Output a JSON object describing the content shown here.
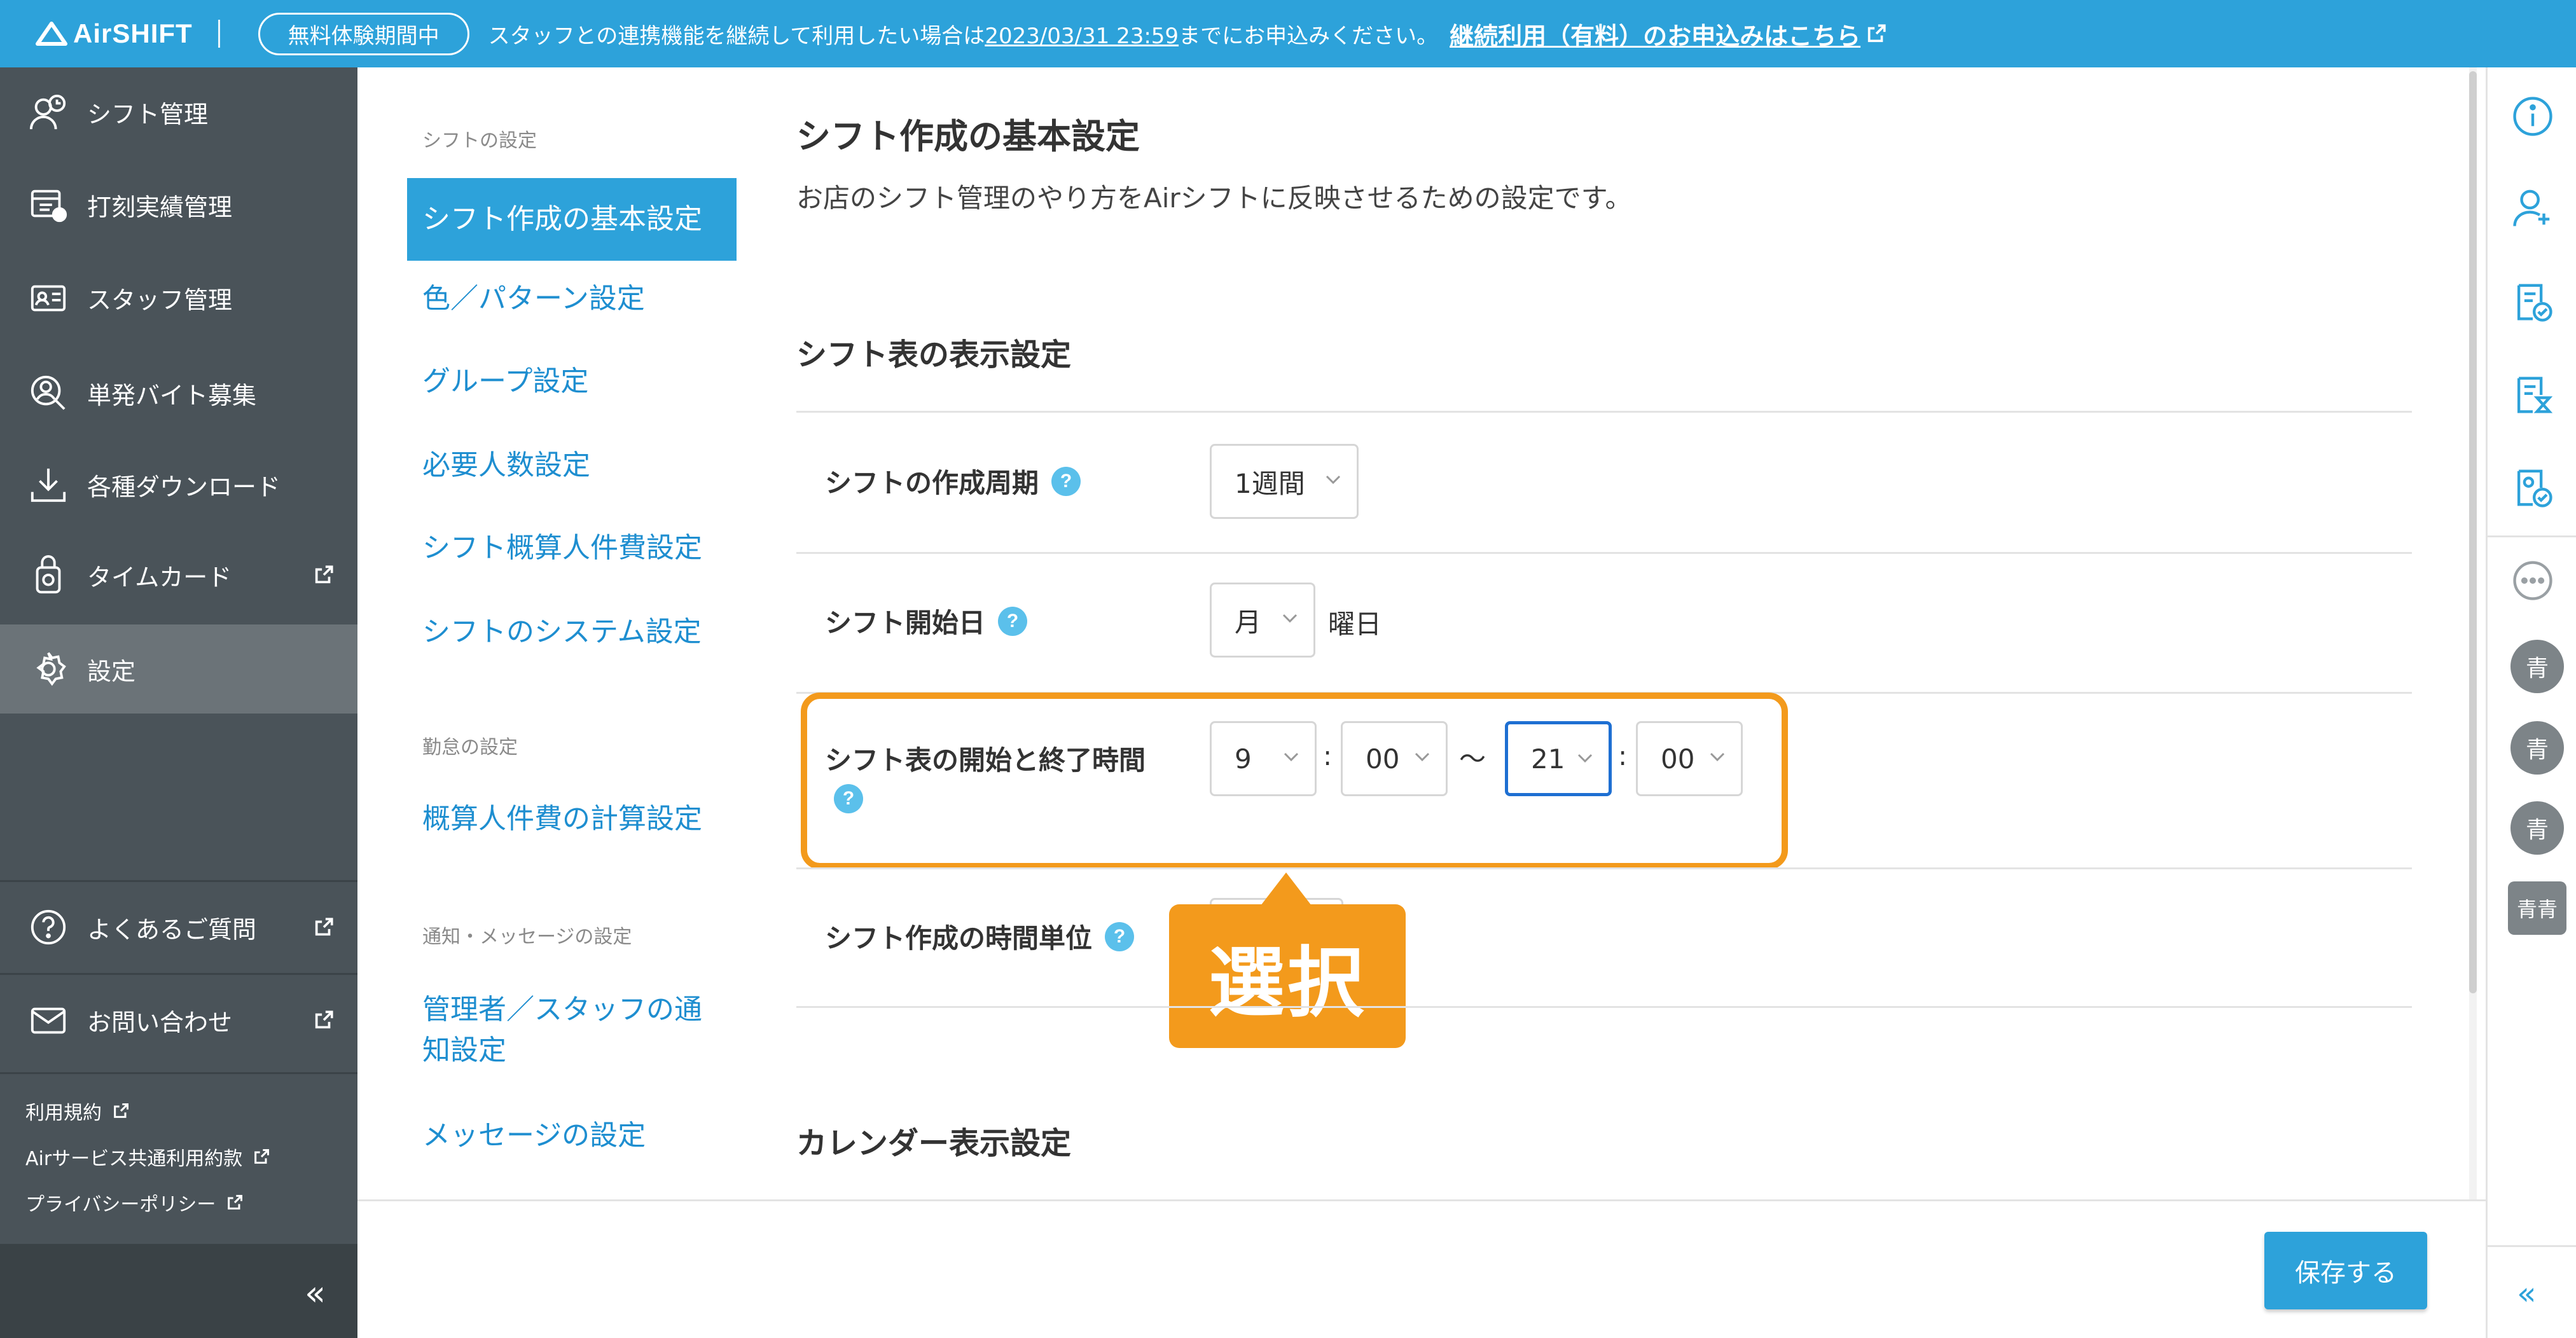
{
  "app": {
    "logo": "AirSHIFT"
  },
  "banner": {
    "trial": "無料体験期間中",
    "message_prefix": "スタッフとの連携機能を継続して利用したい場合は",
    "deadline": "2023/03/31 23:59",
    "message_suffix": "までにお申込みください。",
    "link": "継続利用（有料）のお申込みはこちら"
  },
  "leftnav": {
    "items": [
      {
        "label": "シフト管理",
        "icon": "shift-icon"
      },
      {
        "label": "打刻実績管理",
        "icon": "timesheet-icon"
      },
      {
        "label": "スタッフ管理",
        "icon": "staff-card-icon"
      },
      {
        "label": "単発バイト募集",
        "icon": "recruit-icon"
      },
      {
        "label": "各種ダウンロード",
        "icon": "download-icon"
      },
      {
        "label": "タイムカード",
        "icon": "timecard-icon"
      },
      {
        "label": "設定",
        "icon": "gear-icon"
      }
    ],
    "help": "よくあるご質問",
    "contact": "お問い合わせ",
    "links": [
      "利用規約",
      "Airサービス共通利用約款",
      "プライバシーポリシー"
    ],
    "collapse": "«"
  },
  "subnav": {
    "groups": [
      {
        "heading": "シフトの設定",
        "items": [
          "シフト作成の基本設定",
          "色／パターン設定",
          "グループ設定",
          "必要人数設定",
          "シフト概算人件費設定",
          "シフトのシステム設定"
        ]
      },
      {
        "heading": "勤怠の設定",
        "items": [
          "概算人件費の計算設定"
        ]
      },
      {
        "heading": "通知・メッセージの設定",
        "items": [
          "管理者／スタッフの通",
          "知設定",
          "メッセージの設定"
        ]
      }
    ]
  },
  "main": {
    "title": "シフト作成の基本設定",
    "description": "お店のシフト管理のやり方をAirシフトに反映させるための設定です。",
    "section1": "シフト表の表示設定",
    "rows": {
      "cycle": {
        "label": "シフトの作成周期",
        "value": "1週間"
      },
      "startday": {
        "label": "シフト開始日",
        "value": "月",
        "suffix": "曜日"
      },
      "hours": {
        "label": "シフト表の開始と終了時間",
        "start_h": "9",
        "start_m": "00",
        "sep": ":",
        "tilde": "〜",
        "end_h": "21",
        "end_m": "00"
      },
      "unit": {
        "label": "シフト作成の時間単位"
      }
    },
    "help_mark": "?",
    "callout": "選択",
    "section2": "カレンダー表示設定"
  },
  "footer": {
    "save": "保存する"
  },
  "rightbar": {
    "icons": [
      "info-icon",
      "add-user-icon",
      "shift-request-icon",
      "shift-hourglass-icon",
      "shift-check-icon",
      "chat-icon"
    ],
    "avatars": [
      "青",
      "青",
      "青",
      "青青"
    ],
    "collapse": "«"
  }
}
